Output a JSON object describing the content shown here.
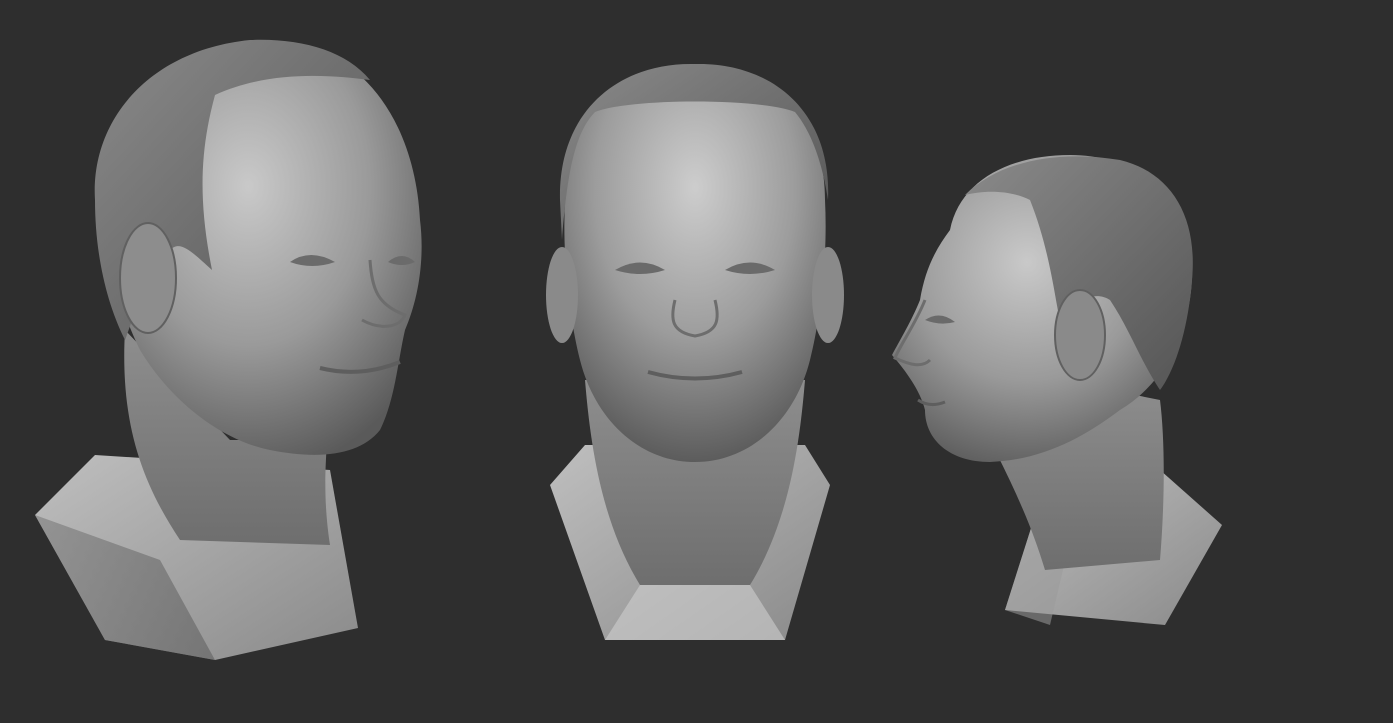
{
  "viewport": {
    "background": "#2e2e2e",
    "material_color": "#9a9a9a",
    "models": [
      {
        "id": "bust-three-quarter-view",
        "view": "three-quarter-right"
      },
      {
        "id": "bust-front-view",
        "view": "front"
      },
      {
        "id": "bust-profile-view",
        "view": "profile-left"
      }
    ]
  }
}
